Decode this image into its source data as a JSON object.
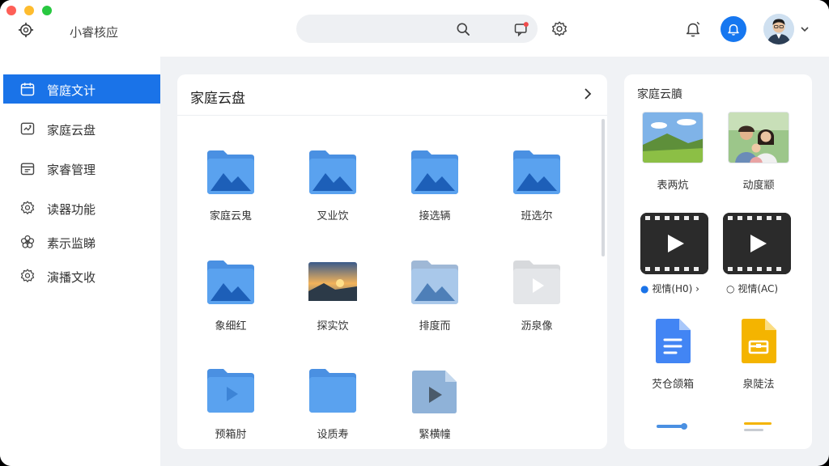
{
  "app": {
    "title": "小睿核应",
    "icon": "app-gear-icon"
  },
  "header": {
    "search_placeholder": "",
    "icons": [
      "search-icon",
      "message-icon",
      "settings-icon",
      "notification-bell-icon",
      "bell-active-icon",
      "avatar",
      "chevron-down-icon"
    ],
    "accent_color": "#1677f0"
  },
  "sidebar": {
    "items": [
      {
        "label": "管庭文计",
        "icon": "calendar-icon",
        "active": true
      },
      {
        "label": "家庭云盘",
        "icon": "cloud-drive-icon",
        "active": false
      },
      {
        "label": "家睿管理",
        "icon": "calendar-manage-icon",
        "active": false
      },
      {
        "label": "读器功能",
        "icon": "gear-icon",
        "active": false
      },
      {
        "label": "素示监睇",
        "icon": "flower-icon",
        "active": false
      },
      {
        "label": "演播文收",
        "icon": "gear-icon",
        "active": false
      }
    ],
    "active_color": "#1a73e8"
  },
  "main": {
    "title": "家庭云盘",
    "items": [
      {
        "label": "家庭云鬼",
        "type": "image-folder"
      },
      {
        "label": "叉业饮",
        "type": "image-folder"
      },
      {
        "label": "接选辆",
        "type": "image-folder"
      },
      {
        "label": "班选尔",
        "type": "image-folder"
      },
      {
        "label": "象细红",
        "type": "image-folder"
      },
      {
        "label": "探实饮",
        "type": "photo"
      },
      {
        "label": "排度而",
        "type": "image-folder-open"
      },
      {
        "label": "沥泉像",
        "type": "video-folder"
      },
      {
        "label": "预箱肘",
        "type": "video-folder"
      },
      {
        "label": "设质寿",
        "type": "folder"
      },
      {
        "label": "緊横幢",
        "type": "video-file"
      }
    ]
  },
  "right_panel": {
    "title": "家庭云膹",
    "photos": [
      {
        "label": "表两炕",
        "type": "landscape-photo"
      },
      {
        "label": "动度颛",
        "type": "family-photo"
      }
    ],
    "videos": [
      {
        "label": "视情(H0)",
        "type": "video"
      },
      {
        "label": "视情(AC)",
        "type": "video"
      }
    ],
    "docs": [
      {
        "label": "芡仓颌箱",
        "type": "document",
        "color": "#4285f4"
      },
      {
        "label": "泉陡法",
        "type": "archive",
        "color": "#f4b400"
      }
    ]
  }
}
